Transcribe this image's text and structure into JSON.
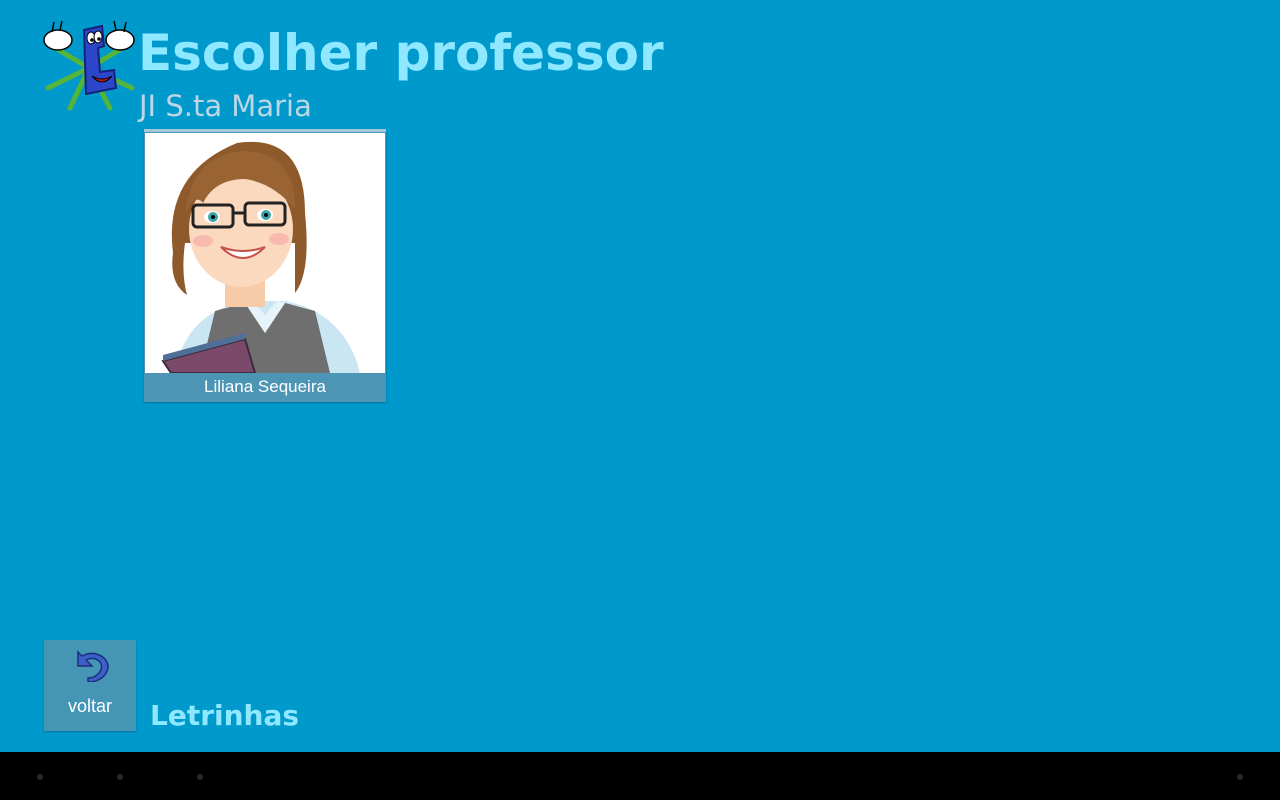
{
  "header": {
    "title": "Escolher professor",
    "subtitle": "JI S.ta Maria",
    "logo_icon": "letter-mascot-icon"
  },
  "teachers": [
    {
      "name": "Liliana Sequeira",
      "photo_icon": "teacher-avatar-icon"
    }
  ],
  "footer": {
    "back_label": "voltar",
    "back_icon": "undo-arrow-icon",
    "brand": "Letrinhas"
  },
  "colors": {
    "background": "#0099cc",
    "title": "#8ee8ff",
    "subtitle": "#bcd6e4",
    "card": "#4c95b5",
    "navbar": "#000000"
  }
}
